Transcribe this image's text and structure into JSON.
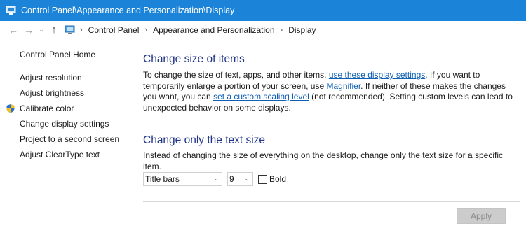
{
  "window": {
    "title": "Control Panel\\Appearance and Personalization\\Display",
    "title_color": "#1b84d8"
  },
  "navigation": {
    "back_icon": "back-arrow-icon",
    "forward_icon": "forward-arrow-icon",
    "recent_icon": "chevron-down-icon",
    "up_icon": "up-arrow-icon",
    "breadcrumb": [
      "Control Panel",
      "Appearance and Personalization",
      "Display"
    ]
  },
  "sidebar": {
    "home": "Control Panel Home",
    "items": [
      {
        "label": "Adjust resolution"
      },
      {
        "label": "Adjust brightness"
      },
      {
        "label": "Calibrate color",
        "icon": "shield-icon"
      },
      {
        "label": "Change display settings"
      },
      {
        "label": "Project to a second screen"
      },
      {
        "label": "Adjust ClearType text"
      }
    ]
  },
  "main": {
    "section1": {
      "heading": "Change size of items",
      "text_1": "To change the size of text, apps, and other items, ",
      "link_1": "use these display settings",
      "text_2": ".  If you want to temporarily enlarge a portion of your screen, use ",
      "link_2": "Magnifier",
      "text_3": ".  If neither of these makes the changes you want, you can ",
      "link_3": "set a custom scaling level",
      "text_4": " (not recommended).  Setting custom levels can lead to unexpected behavior on some displays."
    },
    "section2": {
      "heading": "Change only the text size",
      "description": "Instead of changing the size of everything on the desktop, change only the text size for a specific item.",
      "item_select": "Title bars",
      "size_select": "9",
      "bold_label": "Bold",
      "bold_checked": false
    },
    "apply_label": "Apply"
  },
  "colors": {
    "heading": "#1e3287",
    "link": "#0f5fb5"
  }
}
